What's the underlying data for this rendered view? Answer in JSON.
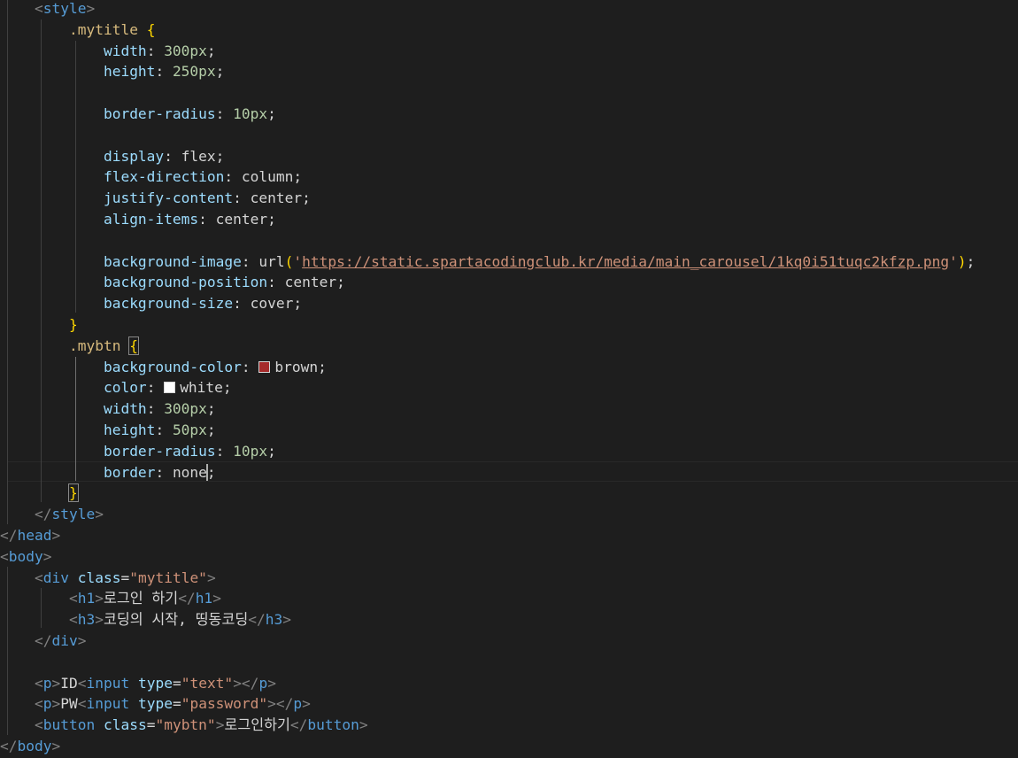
{
  "editor": {
    "lines": {
      "l1": {
        "tag": "style"
      },
      "l2": {
        "selector": ".mytitle"
      },
      "l3": {
        "prop": "width",
        "value": "300px"
      },
      "l4": {
        "prop": "height",
        "value": "250px"
      },
      "l6": {
        "prop": "border-radius",
        "value": "10px"
      },
      "l8": {
        "prop": "display",
        "value": "flex"
      },
      "l9": {
        "prop": "flex-direction",
        "value": "column"
      },
      "l10": {
        "prop": "justify-content",
        "value": "center"
      },
      "l11": {
        "prop": "align-items",
        "value": "center"
      },
      "l13": {
        "prop": "background-image",
        "fn": "url",
        "url": "https://static.spartacodingclub.kr/media/main_carousel/1kq0i51tuqc2kfzp.png"
      },
      "l14": {
        "prop": "background-position",
        "value": "center"
      },
      "l15": {
        "prop": "background-size",
        "value": "cover"
      },
      "l17": {
        "selector": ".mybtn"
      },
      "l18": {
        "prop": "background-color",
        "value": "brown",
        "swatch": "#a52a2a"
      },
      "l19": {
        "prop": "color",
        "value": "white",
        "swatch": "#ffffff"
      },
      "l20": {
        "prop": "width",
        "value": "300px"
      },
      "l21": {
        "prop": "height",
        "value": "50px"
      },
      "l22": {
        "prop": "border-radius",
        "value": "10px"
      },
      "l23": {
        "prop": "border",
        "value_a": "none",
        "value_b": ""
      },
      "l25": {
        "tag": "style"
      },
      "l26": {
        "tag": "head"
      },
      "l27": {
        "tag": "body"
      },
      "l28": {
        "tag": "div",
        "attr": "class",
        "attr_value": "\"mytitle\""
      },
      "l29": {
        "tag": "h1",
        "text": "로그인 하기"
      },
      "l30": {
        "tag": "h3",
        "text": "코딩의 시작, 띵동코딩"
      },
      "l31": {
        "tag": "div"
      },
      "l33": {
        "tag": "p",
        "text": "ID",
        "inner_tag": "input",
        "attr": "type",
        "attr_value": "\"text\""
      },
      "l34": {
        "tag": "p",
        "text": "PW",
        "inner_tag": "input",
        "attr": "type",
        "attr_value": "\"password\""
      },
      "l35": {
        "tag": "button",
        "attr": "class",
        "attr_value": "\"mybtn\"",
        "text": "로그인하기"
      },
      "l36": {
        "tag": "body"
      }
    }
  },
  "colors": {
    "background": "#1e1e1e",
    "tag": "#569cd6",
    "property": "#9cdcfe",
    "number": "#b5cea8",
    "string": "#ce9178",
    "selector": "#d7ba7d",
    "brace": "#ffd700",
    "punctuation": "#808080"
  }
}
